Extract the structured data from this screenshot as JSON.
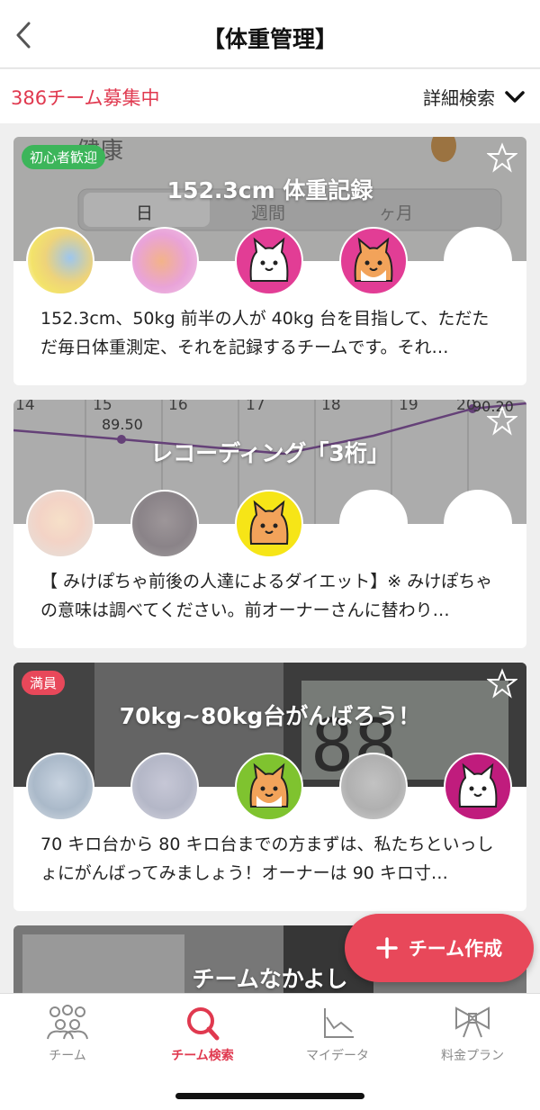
{
  "header": {
    "title": "【体重管理】"
  },
  "subbar": {
    "recruit": "386チーム募集中",
    "detail": "詳細検索"
  },
  "cards": [
    {
      "badge": "初心者歓迎",
      "badge_color": "#3cb55a",
      "title": "152.3cm 体重記録",
      "description": "152.3cm、50kg 前半の人が 40kg 台を目指して、ただただ毎日体重測定、それを記録するチームです。それ…",
      "bg_labels": {
        "day": "日",
        "week": "週間",
        "month": "ヶ月"
      }
    },
    {
      "badge": "",
      "title": "レコーディング「3桁」",
      "description": "【 みけぽちゃ前後の人達によるダイエット】※ みけぽちゃの意味は調べてください。前オーナーさんに替わり…",
      "bg_labels": {
        "v1": "89.50",
        "v2": "90.20",
        "d1": "14",
        "d2": "15",
        "d3": "16",
        "d4": "17",
        "d5": "18",
        "d6": "19",
        "d7": "20"
      }
    },
    {
      "badge": "満員",
      "badge_color": "#e8485a",
      "title": "70kg~80kg台がんばろう！",
      "description": "70 キロ台から 80 キロ台までの方まずは、私たちといっしょにがんばってみましょう！オーナーは 90 キロ寸…"
    },
    {
      "title": "チームなかよし"
    }
  ],
  "fab": {
    "label": "チーム作成"
  },
  "tabs": [
    {
      "label": "チーム",
      "icon": "team-icon"
    },
    {
      "label": "チーム検索",
      "icon": "search-icon"
    },
    {
      "label": "マイデータ",
      "icon": "chart-icon"
    },
    {
      "label": "料金プラン",
      "icon": "ribbon-icon"
    }
  ],
  "colors": {
    "accent": "#e0394f",
    "fab": "#e8485a"
  }
}
